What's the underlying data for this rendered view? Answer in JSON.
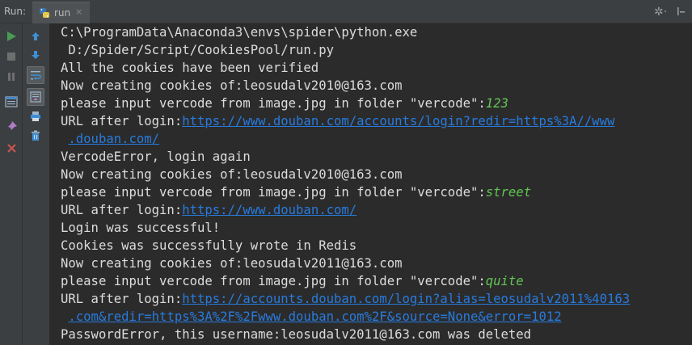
{
  "window": {
    "panel_title": "Run:",
    "tab_label": "run",
    "tab_close": "×",
    "settings_glyph": "✲·"
  },
  "console": {
    "lines": [
      {
        "text": "C:\\ProgramData\\Anaconda3\\envs\\spider\\python.exe"
      },
      {
        "text": " D:/Spider/Script/CookiesPool/run.py"
      },
      {
        "text": "All the cookies have been verified"
      },
      {
        "text": "Now creating cookies of:leosudalv2010@163.com"
      },
      {
        "text": "please input vercode from image.jpg in folder \"vercode\":",
        "input": "123"
      },
      {
        "text": "URL after login:",
        "link": "https://www.douban.com/accounts/login?redir=https%3A//www"
      },
      {
        "text": " ",
        "link": ".douban.com/"
      },
      {
        "text": "VercodeError, login again"
      },
      {
        "text": "Now creating cookies of:leosudalv2010@163.com"
      },
      {
        "text": "please input vercode from image.jpg in folder \"vercode\":",
        "input": "street"
      },
      {
        "text": "URL after login:",
        "link": "https://www.douban.com/"
      },
      {
        "text": "Login was successful!"
      },
      {
        "text": "Cookies was successfully wrote in Redis"
      },
      {
        "text": "Now creating cookies of:leosudalv2011@163.com"
      },
      {
        "text": "please input vercode from image.jpg in folder \"vercode\":",
        "input": "quite"
      },
      {
        "text": "URL after login:",
        "link": "https://accounts.douban.com/login?alias=leosudalv2011%40163"
      },
      {
        "text": " ",
        "link": ".com&redir=https%3A%2F%2Fwww.douban.com%2F&source=None&error=1012"
      },
      {
        "text": "PasswordError, this username:leosudalv2011@163.com was deleted"
      }
    ]
  },
  "colors": {
    "background": "#2b2b2b",
    "text": "#dcdcdc",
    "link": "#287bde",
    "user_input": "#62c554"
  }
}
